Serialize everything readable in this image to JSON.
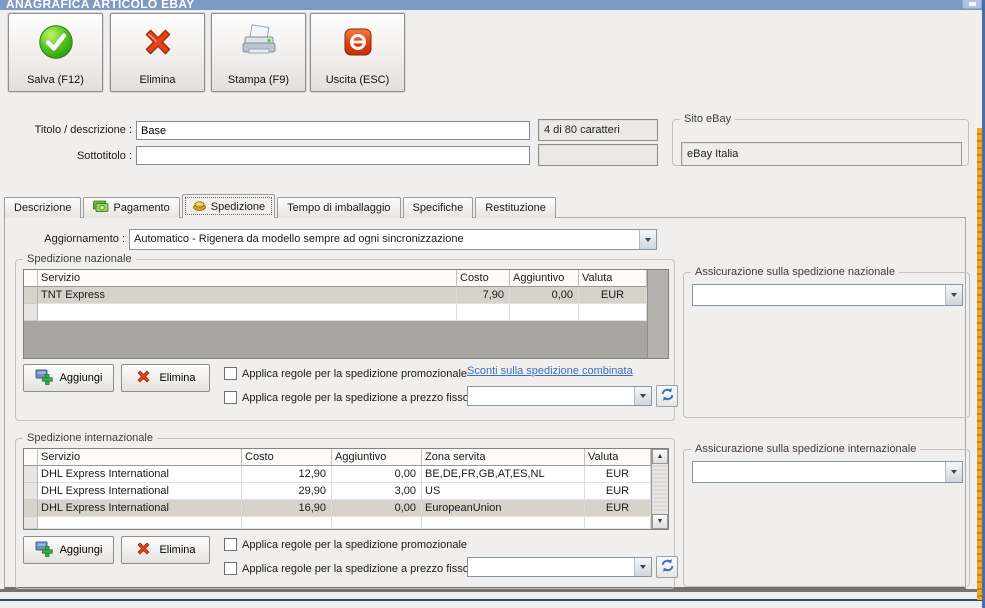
{
  "window": {
    "title": "ANAGRAFICA ARTICOLO EBAY"
  },
  "toolbar": {
    "buttons": [
      {
        "label": "Salva (F12)",
        "icon": "save-check-icon"
      },
      {
        "label": "Elimina",
        "icon": "delete-x-icon"
      },
      {
        "label": "Stampa (F9)",
        "icon": "printer-icon"
      },
      {
        "label": "Uscita (ESC)",
        "icon": "power-icon"
      }
    ]
  },
  "header": {
    "titolo_label": "Titolo / descrizione :",
    "titolo_value": "Base",
    "titolo_counter": "4 di 80 caratteri",
    "sottotitolo_label": "Sottotitolo :",
    "sottotitolo_value": "",
    "sottotitolo_counter": "",
    "sito_ebay_label": "Sito eBay",
    "sito_ebay_value": "eBay Italia"
  },
  "tabs": [
    {
      "label": "Descrizione"
    },
    {
      "label": "Pagamento",
      "icon": "money-icon"
    },
    {
      "label": "Spedizione",
      "icon": "package-icon",
      "selected": true
    },
    {
      "label": "Tempo di imballaggio"
    },
    {
      "label": "Specifiche"
    },
    {
      "label": "Restituzione"
    }
  ],
  "spedizione_tab": {
    "aggiornamento_label": "Aggiornamento :",
    "aggiornamento_value": "Automatico - Rigenera da modello sempre ad ogni sincronizzazione",
    "nazionale": {
      "group_title": "Spedizione nazionale",
      "columns": [
        "Servizio",
        "Costo",
        "Aggiuntivo",
        "Valuta"
      ],
      "rows": [
        {
          "servizio": "TNT Express",
          "costo": "7,90",
          "aggiuntivo": "0,00",
          "valuta": "EUR",
          "selected": true
        }
      ],
      "aggiungi_label": "Aggiungi",
      "elimina_label": "Elimina",
      "checkbox_promozionale": "Applica regole per la spedizione promozionale",
      "checkbox_prezzo_fisso": "Applica regole per la spedizione a prezzo fisso",
      "sconti_link": "Sconti sulla spedizione combinata",
      "prezzo_fisso_value": "",
      "assicurazione_title": "Assicurazione sulla spedizione nazionale",
      "assicurazione_value": ""
    },
    "internazionale": {
      "group_title": "Spedizione internazionale",
      "columns": [
        "Servizio",
        "Costo",
        "Aggiuntivo",
        "Zona servita",
        "Valuta"
      ],
      "rows": [
        {
          "servizio": "DHL Express International",
          "costo": "12,90",
          "aggiuntivo": "0,00",
          "zona": "BE,DE,FR,GB,AT,ES,NL",
          "valuta": "EUR"
        },
        {
          "servizio": "DHL Express International",
          "costo": "29,90",
          "aggiuntivo": "3,00",
          "zona": "US",
          "valuta": "EUR"
        },
        {
          "servizio": "DHL Express International",
          "costo": "16,90",
          "aggiuntivo": "0,00",
          "zona": "EuropeanUnion",
          "valuta": "EUR",
          "selected": true
        }
      ],
      "aggiungi_label": "Aggiungi",
      "elimina_label": "Elimina",
      "checkbox_promozionale": "Applica regole per la spedizione promozionale",
      "checkbox_prezzo_fisso": "Applica regole per la spedizione a prezzo fisso",
      "prezzo_fisso_value": "",
      "assicurazione_title": "Assicurazione sulla spedizione internazionale",
      "assicurazione_value": ""
    }
  },
  "colors": {
    "titlebar_blue": "#7c9ac3",
    "accent_orange_strip": "#f0a81f",
    "link_blue": "#3b6fc4",
    "selected_row_gray": "#d7d3cb",
    "grid_fill_gray": "#a8a6a2"
  }
}
